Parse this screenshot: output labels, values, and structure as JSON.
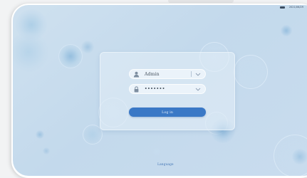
{
  "status_bar": {
    "time_text": "2021/06/29"
  },
  "login": {
    "username_value": "Admin",
    "password_value": "•••••••",
    "login_label": "Log in"
  },
  "footer": {
    "language_label": "Language"
  },
  "colors": {
    "accent": "#3a78c6",
    "background": "#c8dcee",
    "text": "#3f4b58",
    "link": "#4a7ab8"
  },
  "icons": {
    "username": "user-icon",
    "password": "lock-icon",
    "dropdown": "chevron-down-icon",
    "status": "battery-icon"
  }
}
